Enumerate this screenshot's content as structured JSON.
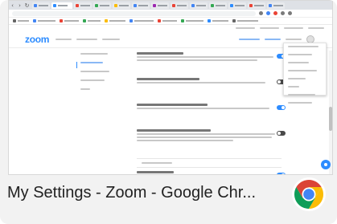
{
  "window": {
    "caption": "My Settings - Zoom - Google Chr...",
    "app_icon": "chrome-logo-icon"
  },
  "zoom": {
    "logo": "zoom"
  }
}
